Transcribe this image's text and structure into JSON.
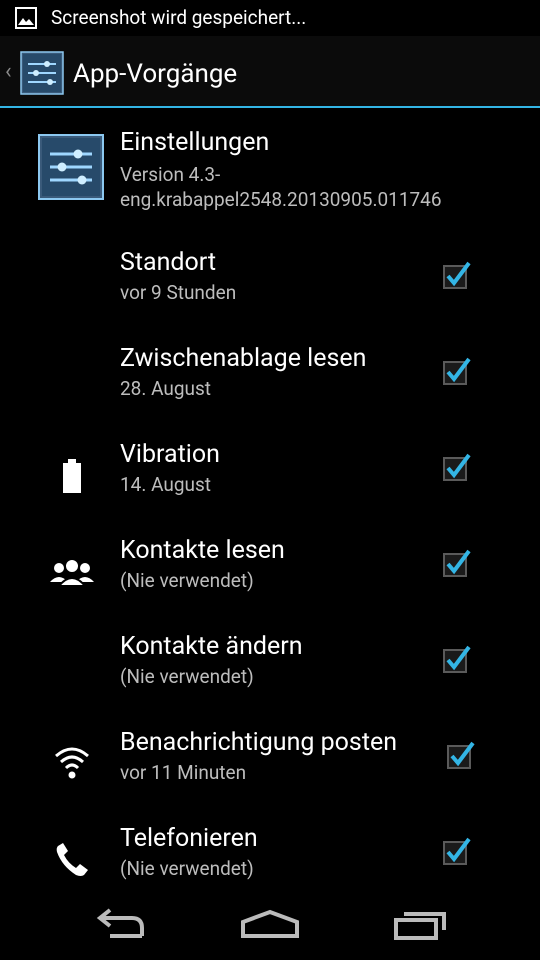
{
  "status_bar": {
    "text": "Screenshot wird gespeichert...",
    "icon": "image-icon"
  },
  "action_bar": {
    "title": "App-Vorgänge",
    "icon": "settings-sliders-icon"
  },
  "app": {
    "name": "Einstellungen",
    "version": "Version 4.3-eng.krabappel2548.20130905.011746",
    "icon": "settings-sliders-icon"
  },
  "permissions": [
    {
      "title": "Standort",
      "subtitle": "vor 9 Stunden",
      "icon": "",
      "checked": true
    },
    {
      "title": "Zwischenablage lesen",
      "subtitle": "28. August",
      "icon": "",
      "checked": true
    },
    {
      "title": "Vibration",
      "subtitle": "14. August",
      "icon": "battery-icon",
      "checked": true
    },
    {
      "title": "Kontakte lesen",
      "subtitle": "(Nie verwendet)",
      "icon": "contacts-icon",
      "checked": true
    },
    {
      "title": "Kontakte ändern",
      "subtitle": "(Nie verwendet)",
      "icon": "",
      "checked": true
    },
    {
      "title": "Benachrichtigung posten",
      "subtitle": "vor 11 Minuten",
      "icon": "wifi-icon",
      "checked": true
    },
    {
      "title": "Telefonieren",
      "subtitle": "(Nie verwendet)",
      "icon": "phone-icon",
      "checked": true
    }
  ],
  "nav_bar": {
    "back": "back-icon",
    "home": "home-icon",
    "recents": "recents-icon"
  },
  "colors": {
    "accent": "#33b5e5",
    "background": "#000000",
    "secondary_text": "#bdbdbd"
  }
}
